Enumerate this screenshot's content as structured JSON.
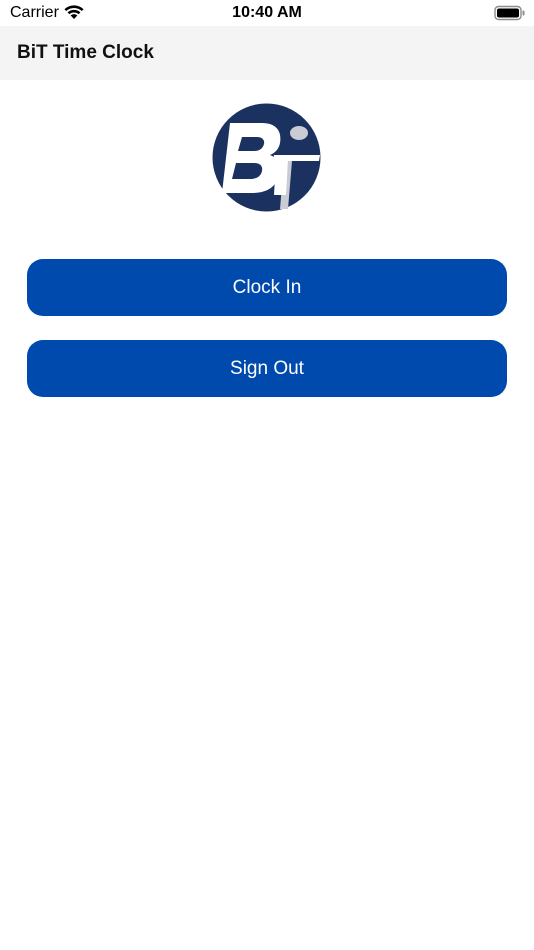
{
  "status_bar": {
    "carrier": "Carrier",
    "time": "10:40 AM",
    "wifi_icon": "wifi-icon",
    "battery_icon": "battery-icon"
  },
  "nav": {
    "title": "BiT Time Clock"
  },
  "logo": {
    "icon": "bit-logo",
    "text": "BiT",
    "colors": {
      "circle": "#1b3261",
      "letters": "#ffffff",
      "shadow": "#c9ccd3"
    }
  },
  "actions": {
    "clock_in_label": "Clock In",
    "sign_out_label": "Sign Out"
  },
  "colors": {
    "button_bg": "#0049ad",
    "button_text": "#ffffff",
    "nav_bg": "#f4f4f4",
    "background": "#ffffff"
  }
}
